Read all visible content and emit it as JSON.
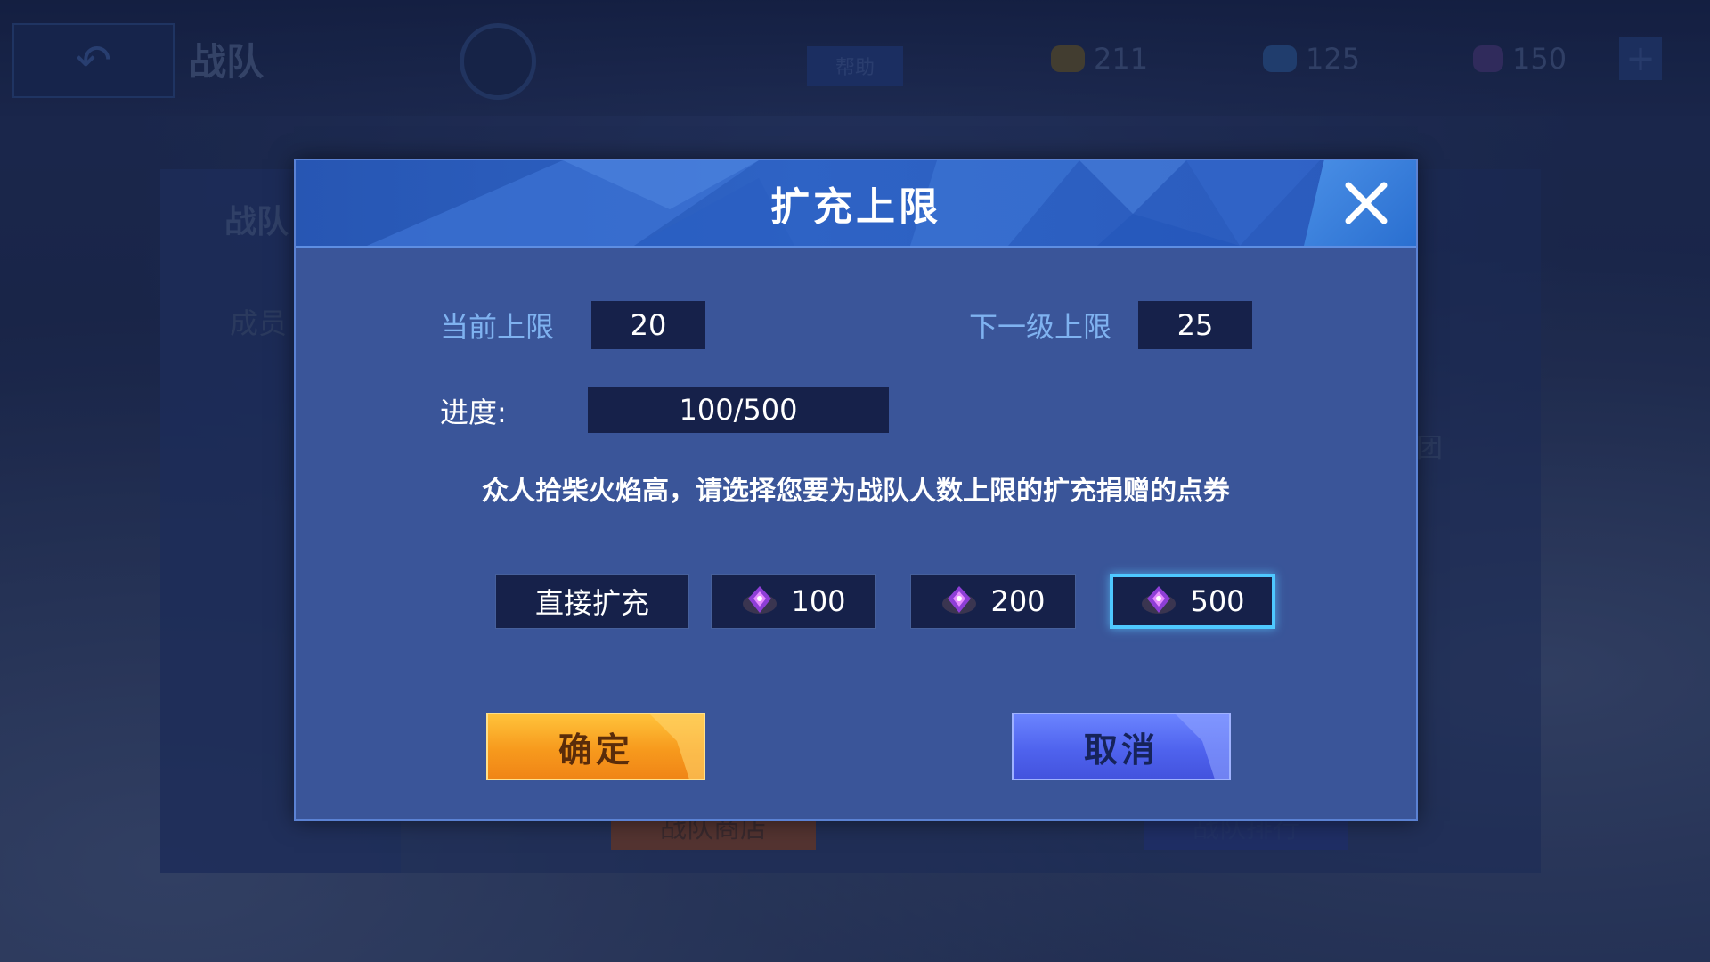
{
  "background": {
    "title": "战队",
    "help_label": "帮助",
    "currencies": [
      {
        "icon": "coupon-icon",
        "value": "211"
      },
      {
        "icon": "diamond-icon",
        "value": "125"
      },
      {
        "icon": "crystal-icon",
        "value": "150"
      }
    ],
    "side_tabs": [
      "战队",
      "成员"
    ],
    "side_text": "团",
    "bottom_buttons": [
      "战队商店",
      "战队排行"
    ]
  },
  "dialog": {
    "title": "扩充上限",
    "current_limit_label": "当前上限",
    "current_limit_value": "20",
    "next_limit_label": "下一级上限",
    "next_limit_value": "25",
    "progress_label": "进度:",
    "progress_value": "100/500",
    "progress_fraction": 0.2,
    "message": "众人拾柴火焰高，请选择您要为战队人数上限的扩充捐赠的点券",
    "options": [
      {
        "label": "直接扩充",
        "icon": null,
        "selected": false
      },
      {
        "label": "100",
        "icon": "point-gem-icon",
        "selected": false
      },
      {
        "label": "200",
        "icon": "point-gem-icon",
        "selected": false
      },
      {
        "label": "500",
        "icon": "point-gem-icon",
        "selected": true
      }
    ],
    "confirm_label": "确定",
    "cancel_label": "取消"
  },
  "colors": {
    "accent_blue": "#7fb2f0",
    "confirm_orange": "#f79a1d",
    "cancel_blue": "#4f63ee",
    "selected_border": "#4ec8ff"
  }
}
